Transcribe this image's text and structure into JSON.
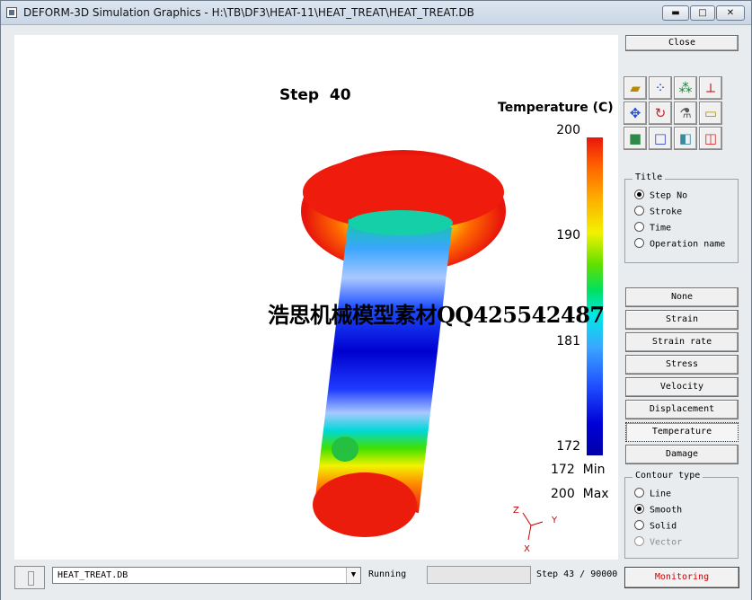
{
  "window": {
    "title": "DEFORM-3D Simulation Graphics - H:\\TB\\DF3\\HEAT-11\\HEAT_TREAT\\HEAT_TREAT.DB",
    "min_label": "▬",
    "max_label": "□",
    "close_label": "✕"
  },
  "viewport": {
    "step_title": "Step  40",
    "legend_title": "Temperature (C)",
    "ticks": [
      "200",
      "190",
      "181",
      "172"
    ],
    "min_text": "172  Min",
    "max_text": "200  Max",
    "watermark": "浩思机械模型素材QQ425542487",
    "axes": {
      "z": "Z",
      "y": "Y",
      "x": "X"
    },
    "colors": {
      "hot": "#e8160c",
      "cold": "#0000a8",
      "axis": "#c00000"
    }
  },
  "panel": {
    "close_label": "Close",
    "tool_icons": [
      "open-folder-icon",
      "nodes-icon",
      "molecules-icon",
      "plot-axes-icon",
      "center-icon",
      "rotate-icon",
      "spray-icon",
      "ruler-icon",
      "solid-box-icon",
      "wire-box-icon",
      "shaded-box-icon",
      "red-box-icon"
    ],
    "title_group": {
      "label": "Title",
      "options": [
        "Step No",
        "Stroke",
        "Time",
        "Operation name"
      ],
      "selected": "Step No"
    },
    "variables": [
      "None",
      "Strain",
      "Strain rate",
      "Stress",
      "Velocity",
      "Displacement",
      "Temperature",
      "Damage"
    ],
    "active_variable": "Temperature",
    "contour_group": {
      "label": "Contour type",
      "options": [
        "Line",
        "Smooth",
        "Solid",
        "Vector"
      ],
      "selected": "Smooth",
      "disabled": "Vector"
    }
  },
  "status": {
    "db_value": "HEAT_TREAT.DB",
    "state": "Running",
    "step_text": "Step 43 / 90000",
    "monitor_label": "Monitoring"
  }
}
